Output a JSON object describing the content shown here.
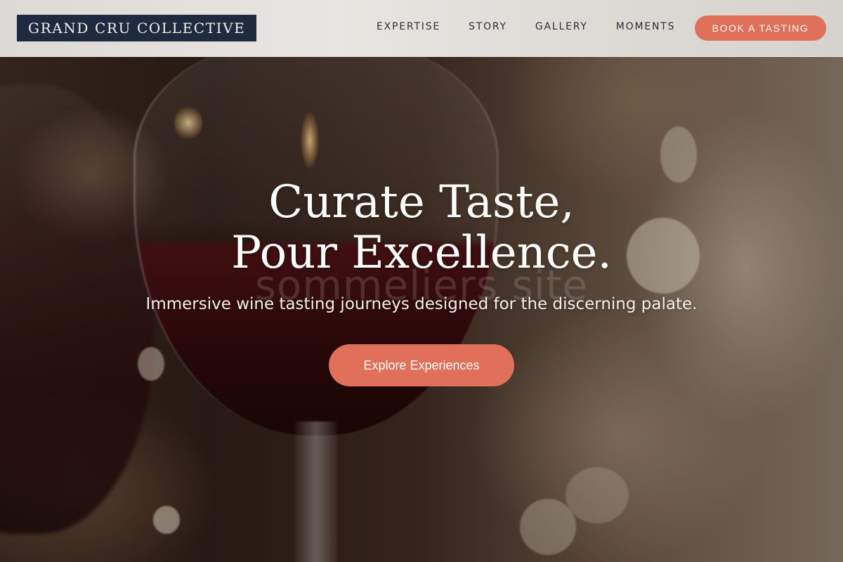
{
  "brand": {
    "name": "GRAND CRU COLLECTIVE"
  },
  "nav": {
    "links": [
      {
        "label": "EXPERTISE"
      },
      {
        "label": "STORY"
      },
      {
        "label": "GALLERY"
      },
      {
        "label": "MOMENTS"
      }
    ],
    "cta_label": "BOOK A TASTING"
  },
  "hero": {
    "headline": "Curate Taste, Pour Excellence.",
    "watermark": "sommeliers site",
    "subtitle": "Immersive wine tasting journeys designed for the discerning palate.",
    "cta_label": "Explore Experiences"
  },
  "colors": {
    "brand_bg": "#1e2a3f",
    "accent": "#e0705a",
    "nav_bg": "#e4e1de"
  }
}
